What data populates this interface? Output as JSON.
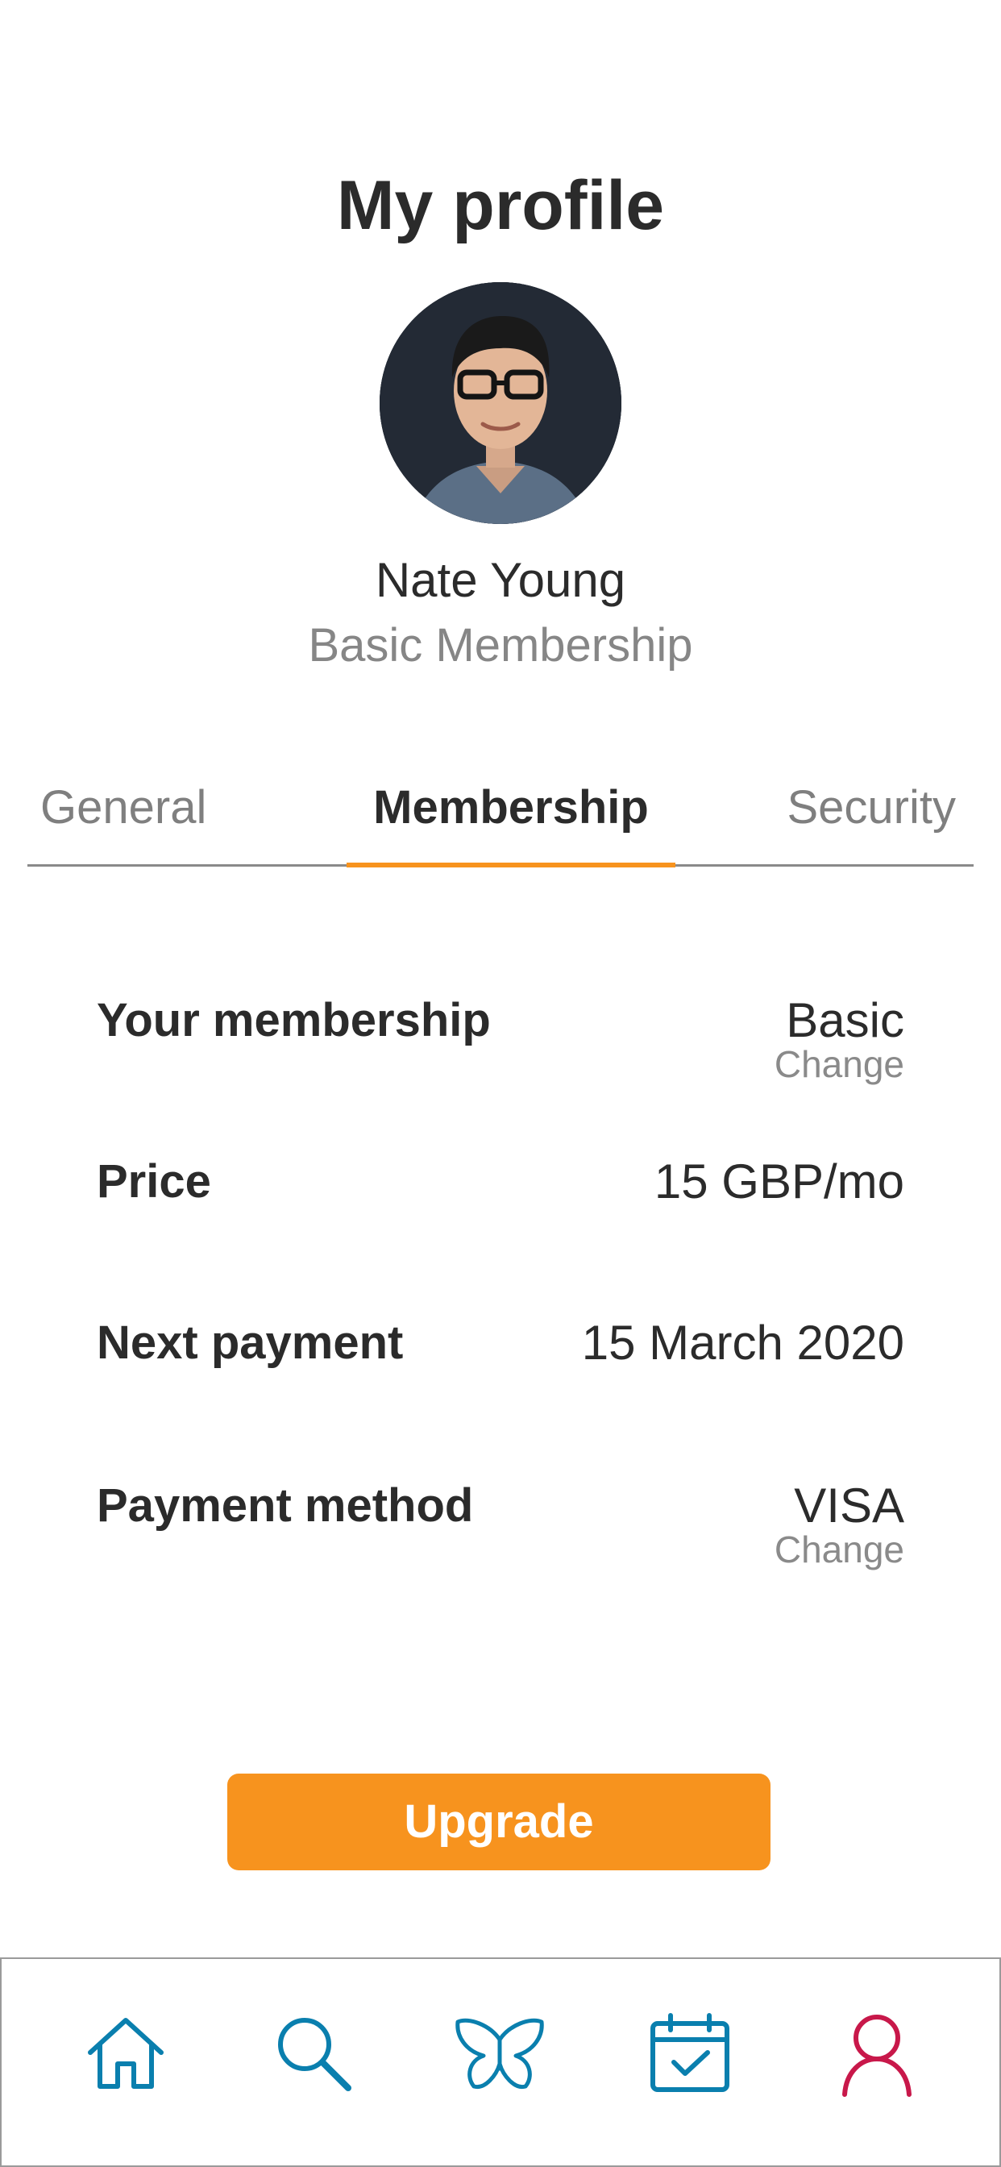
{
  "header": {
    "title": "My profile"
  },
  "profile": {
    "avatar_icon": "user-portrait",
    "name": "Nate Young",
    "membership_label": "Basic Membership"
  },
  "tabs": [
    {
      "label": "General",
      "active": false
    },
    {
      "label": "Membership",
      "active": true
    },
    {
      "label": "Security",
      "active": false
    }
  ],
  "membership_details": {
    "your_membership": {
      "label": "Your membership",
      "value": "Basic",
      "action": "Change"
    },
    "price": {
      "label": "Price",
      "value": "15 GBP/mo"
    },
    "next_payment": {
      "label": "Next payment",
      "value": "15 March 2020"
    },
    "payment_method": {
      "label": "Payment method",
      "value": "VISA",
      "action": "Change"
    }
  },
  "upgrade_button": {
    "label": "Upgrade"
  },
  "bottom_nav": {
    "items": [
      {
        "icon": "home-icon",
        "active": false
      },
      {
        "icon": "search-icon",
        "active": false
      },
      {
        "icon": "butterfly-icon",
        "active": false
      },
      {
        "icon": "calendar-icon",
        "active": false
      },
      {
        "icon": "profile-icon",
        "active": true
      }
    ]
  },
  "colors": {
    "accent": "#f7931e",
    "nav_icon": "#0a7fae",
    "nav_active": "#c8184a",
    "text_primary": "#2b2b2b",
    "text_secondary": "#868686"
  }
}
